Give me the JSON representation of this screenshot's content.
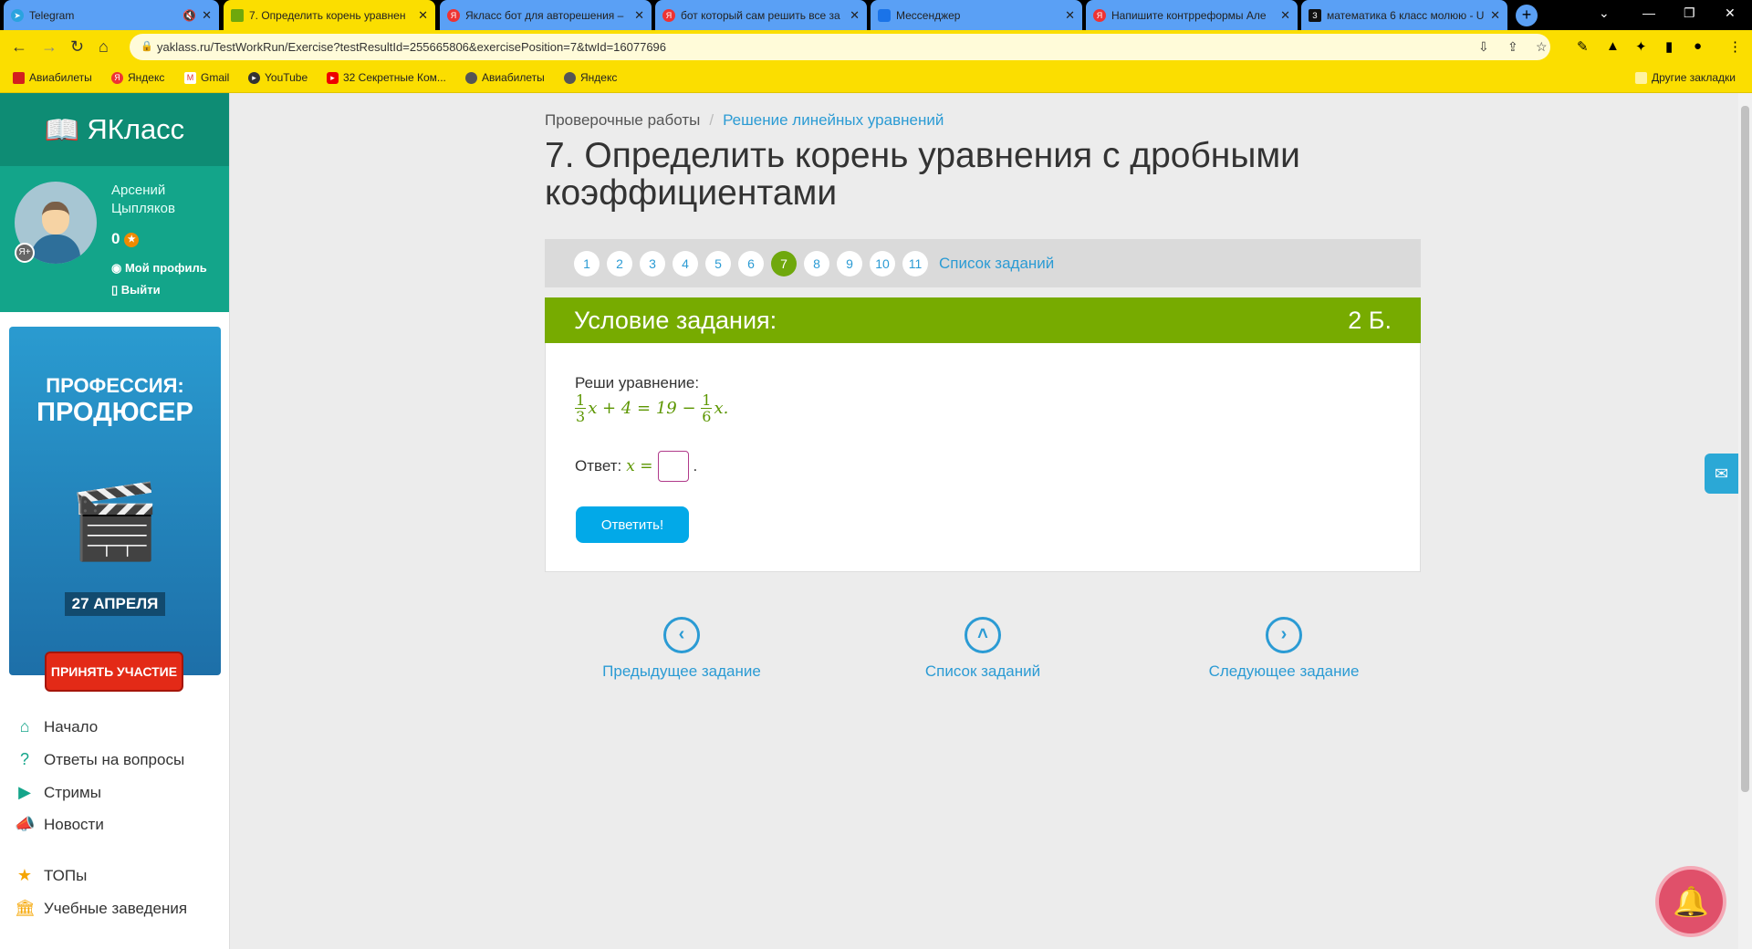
{
  "browser": {
    "tabs": [
      {
        "title": "Telegram",
        "icon": "telegram-icon",
        "muted": true
      },
      {
        "title": "7. Определить корень уравнен",
        "icon": "yaklass-icon",
        "active": true
      },
      {
        "title": "Якласс бот для авторешения –",
        "icon": "yandex-icon"
      },
      {
        "title": "бот который сам решить все за",
        "icon": "yandex-icon"
      },
      {
        "title": "Мессенджер",
        "icon": "messenger-icon"
      },
      {
        "title": "Напишите контрреформы Але",
        "icon": "yandex-icon"
      },
      {
        "title": "математика 6 класс молюю - U",
        "icon": "z-icon"
      }
    ],
    "url": "yaklass.ru/TestWorkRun/Exercise?testResultId=255665806&exercisePosition=7&twId=16077696",
    "bookmarks": [
      "Авиабилеты",
      "Яндекс",
      "Gmail",
      "YouTube",
      "32 Секретные Ком...",
      "Авиабилеты",
      "Яндекс"
    ],
    "other_bookmarks": "Другие закладки"
  },
  "sidebar": {
    "logo": "ЯКласс",
    "user": {
      "name": "Арсений Цыпляков",
      "score": "0",
      "badge": "Я+",
      "profile_link": "Мой профиль",
      "logout_link": "Выйти"
    },
    "ad": {
      "line1": "ПРОФЕССИЯ:",
      "line2": "ПРОДЮСЕР",
      "date": "27 АПРЕЛЯ",
      "cta": "ПРИНЯТЬ УЧАСТИЕ"
    },
    "nav": [
      {
        "label": "Начало",
        "icon": "home-icon"
      },
      {
        "label": "Ответы на вопросы",
        "icon": "question-icon"
      },
      {
        "label": "Стримы",
        "icon": "play-icon"
      },
      {
        "label": "Новости",
        "icon": "megaphone-icon"
      },
      {
        "label": "ТОПы",
        "icon": "star-icon"
      },
      {
        "label": "Учебные заведения",
        "icon": "institution-icon"
      }
    ]
  },
  "main": {
    "breadcrumb": [
      "Проверочные работы",
      "Решение линейных уравнений"
    ],
    "title": "7. Определить корень уравнения с дробными коэффициентами",
    "pager": {
      "pages": [
        "1",
        "2",
        "3",
        "4",
        "5",
        "6",
        "7",
        "8",
        "9",
        "10",
        "11"
      ],
      "current": "7",
      "list_link": "Список заданий"
    },
    "condition_header": "Условие задания:",
    "points": "2 Б.",
    "task_text": "Реши уравнение:",
    "equation": {
      "f1n": "1",
      "f1d": "3",
      "mid": "x + 4 = 19 − ",
      "f2n": "1",
      "f2d": "6",
      "end": "x."
    },
    "answer_label": "Ответ:",
    "answer_var": "x =",
    "answer_value": "",
    "answer_end": ".",
    "submit": "Ответить!",
    "bottom_nav": {
      "prev": "Предыдущее задание",
      "list": "Список заданий",
      "next": "Следующее задание"
    }
  }
}
